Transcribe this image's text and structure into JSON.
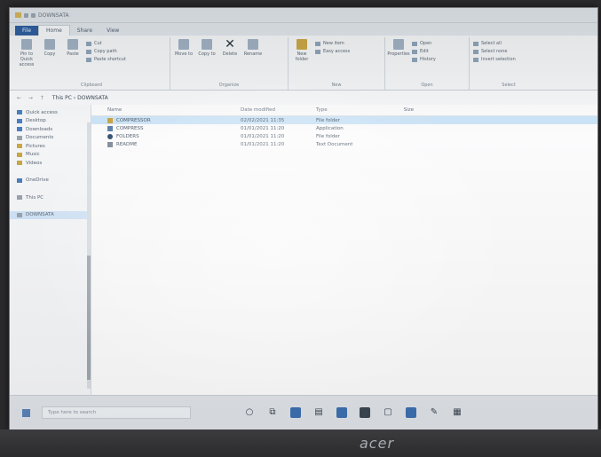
{
  "window": {
    "title": "DOWNSATA"
  },
  "tabs": [
    {
      "label": "File"
    },
    {
      "label": "Home"
    },
    {
      "label": "Share"
    },
    {
      "label": "View"
    }
  ],
  "ribbon": {
    "groups": [
      {
        "label": "Clipboard",
        "buttons": [
          "Pin to Quick access",
          "Copy",
          "Paste"
        ],
        "small": [
          "Cut",
          "Copy path",
          "Paste shortcut"
        ]
      },
      {
        "label": "Organize",
        "buttons": [
          "Move to",
          "Copy to",
          "Delete",
          "Rename"
        ]
      },
      {
        "label": "New",
        "buttons": [
          "New folder"
        ],
        "small": [
          "New item",
          "Easy access"
        ]
      },
      {
        "label": "Open",
        "buttons": [
          "Properties"
        ],
        "small": [
          "Open",
          "Edit",
          "History"
        ]
      },
      {
        "label": "Select",
        "small": [
          "Select all",
          "Select none",
          "Invert selection"
        ]
      }
    ]
  },
  "address": {
    "path": "This PC › DOWNSATA"
  },
  "nav_pane": {
    "items": [
      {
        "label": "Quick access"
      },
      {
        "label": "Desktop"
      },
      {
        "label": "Downloads"
      },
      {
        "label": "Documents"
      },
      {
        "label": "Pictures"
      },
      {
        "label": "Music"
      },
      {
        "label": "Videos"
      },
      {
        "label": "OneDrive"
      },
      {
        "label": "This PC"
      },
      {
        "label": "DOWNSATA"
      }
    ]
  },
  "columns": {
    "name": "Name",
    "date": "Date modified",
    "type": "Type",
    "size": "Size"
  },
  "files": [
    {
      "name": "COMPRESSOR",
      "date": "02/02/2021 11:35",
      "type": "File folder",
      "size": "",
      "selected": true
    },
    {
      "name": "COMPRESS",
      "date": "01/01/2021 11:20",
      "type": "Application",
      "size": "",
      "selected": false
    },
    {
      "name": "FOLDERS",
      "date": "01/01/2021 11:20",
      "type": "File folder",
      "size": "",
      "selected": false
    },
    {
      "name": "README",
      "date": "01/01/2021 11:20",
      "type": "Text Document",
      "size": "",
      "selected": false
    }
  ],
  "taskbar": {
    "search_placeholder": "Type here to search"
  },
  "device": {
    "brand": "acer"
  },
  "colors": {
    "file_tab": "#2f5f9e",
    "selection": "#cce4f7",
    "folder": "#c9a646"
  }
}
